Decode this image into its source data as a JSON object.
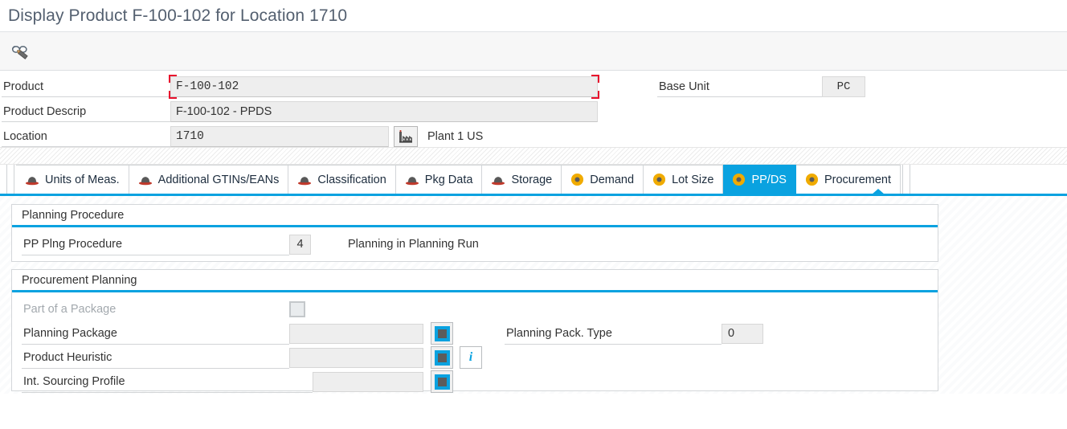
{
  "window": {
    "title": "Display Product F-100-102 for Location 1710"
  },
  "toolbar": {
    "display_change_icon": "glasses-pencil-icon",
    "display_change_tooltip": "Display/Change"
  },
  "header_form": {
    "product_label": "Product",
    "product_value": "F-100-102",
    "product_descrip_label": "Product Descrip",
    "product_descrip_value": "F-100-102 - PPDS",
    "location_label": "Location",
    "location_value": "1710",
    "location_icon": "plant-factory-icon",
    "location_text": "Plant 1 US",
    "base_unit_label": "Base Unit",
    "base_unit_value": "PC"
  },
  "tabs": [
    {
      "label": "Units of Meas.",
      "icon": "hat-icon",
      "active": false
    },
    {
      "label": "Additional GTINs/EANs",
      "icon": "hat-icon",
      "active": false
    },
    {
      "label": "Classification",
      "icon": "hat-icon",
      "active": false
    },
    {
      "label": "Pkg Data",
      "icon": "hat-icon",
      "active": false
    },
    {
      "label": "Storage",
      "icon": "hat-icon",
      "active": false
    },
    {
      "label": "Demand",
      "icon": "orb-icon",
      "active": false
    },
    {
      "label": "Lot Size",
      "icon": "orb-icon",
      "active": false
    },
    {
      "label": "PP/DS",
      "icon": "orb-icon",
      "active": true
    },
    {
      "label": "Procurement",
      "icon": "orb-icon",
      "active": false
    }
  ],
  "planning_procedure": {
    "section_title": "Planning Procedure",
    "pp_plng_procedure_label": "PP Plng Procedure",
    "pp_plng_procedure_value": "4",
    "pp_plng_procedure_desc": "Planning in Planning Run"
  },
  "procurement_planning": {
    "section_title": "Procurement Planning",
    "part_of_package_label": "Part of a Package",
    "part_of_package_checked": false,
    "planning_package_label": "Planning Package",
    "planning_package_value": "",
    "product_heuristic_label": "Product Heuristic",
    "product_heuristic_value": "",
    "int_sourcing_profile_label": "Int. Sourcing Profile",
    "int_sourcing_profile_value": "",
    "planning_pack_type_label": "Planning Pack. Type",
    "planning_pack_type_value": "0",
    "value_help_icon": "value-help-icon",
    "info_icon": "info-icon"
  },
  "colors": {
    "accent_blue": "#0aa2e0",
    "required_red": "#e8112d",
    "tab_orange": "#f0ab00",
    "title_grey": "#546070"
  }
}
